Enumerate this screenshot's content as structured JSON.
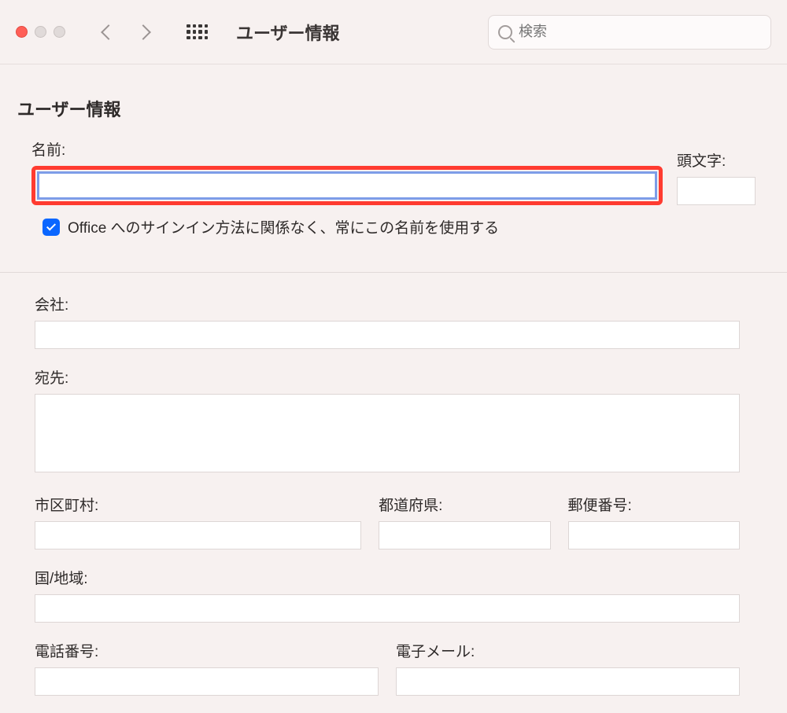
{
  "toolbar": {
    "title": "ユーザー情報",
    "search_placeholder": "検索"
  },
  "section1": {
    "heading": "ユーザー情報",
    "name_label": "名前:",
    "name_value": "",
    "initials_label": "頭文字:",
    "initials_value": "",
    "checkbox_checked": true,
    "checkbox_label": "Office へのサインイン方法に関係なく、常にこの名前を使用する"
  },
  "section2": {
    "company_label": "会社:",
    "company_value": "",
    "address_label": "宛先:",
    "address_value": "",
    "city_label": "市区町村:",
    "city_value": "",
    "prefecture_label": "都道府県:",
    "prefecture_value": "",
    "postal_label": "郵便番号:",
    "postal_value": "",
    "country_label": "国/地域:",
    "country_value": "",
    "phone_label": "電話番号:",
    "phone_value": "",
    "email_label": "電子メール:",
    "email_value": ""
  }
}
